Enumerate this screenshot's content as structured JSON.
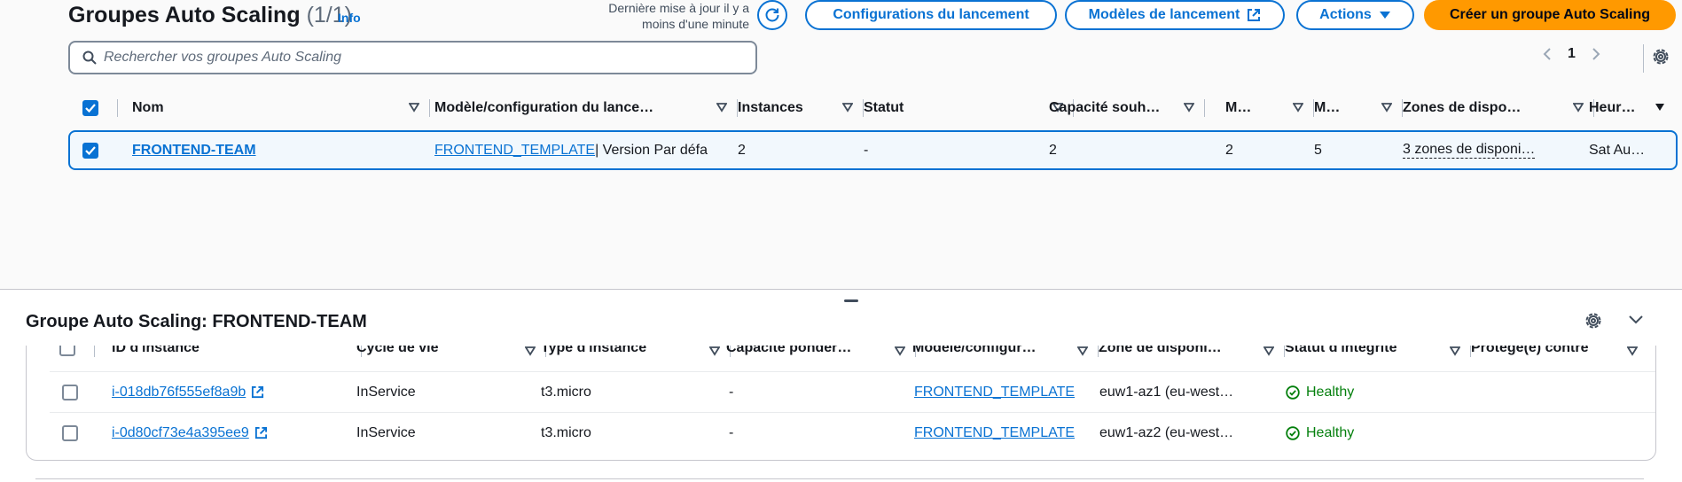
{
  "header": {
    "title": "Groupes Auto Scaling",
    "count": "(1/1)",
    "info": "Info",
    "updated_line1": "Dernière mise à jour il y a",
    "updated_line2": "moins d'une minute"
  },
  "toolbar": {
    "launch_configs": "Configurations du lancement",
    "launch_templates": "Modèles de lancement",
    "actions": "Actions",
    "create": "Créer un groupe Auto Scaling"
  },
  "search": {
    "placeholder": "Rechercher vos groupes Auto Scaling"
  },
  "pagination": {
    "page": "1"
  },
  "groups_table": {
    "columns": [
      "Nom",
      "Modèle/configuration du lance…",
      "Instances",
      "Statut",
      "Capacité souh…",
      "M…",
      "M…",
      "Zones de dispo…",
      "Heur…"
    ],
    "rows": [
      {
        "name": "FRONTEND-TEAM",
        "template_link": "FRONTEND_TEMPLATE",
        "template_suffix": " | Version Par défa",
        "instances": "2",
        "status": "-",
        "desired": "2",
        "min": "2",
        "max": "5",
        "zones": "3 zones de disponi…",
        "time": "Sat Au…"
      }
    ]
  },
  "details": {
    "title": "Groupe Auto Scaling: FRONTEND-TEAM",
    "columns": [
      "ID d'instance",
      "Cycle de vie",
      "Type d'instance",
      "Capacité pondér…",
      "Modèle/configur…",
      "Zone de disponi…",
      "Statut d'intégrité",
      "Protégé(e) contre"
    ],
    "rows": [
      {
        "id": "i-018db76f555ef8a9b",
        "lifecycle": "InService",
        "type": "t3.micro",
        "weight": "-",
        "template": "FRONTEND_TEMPLATE",
        "zone": "euw1-az1 (eu-west…",
        "health": "Healthy"
      },
      {
        "id": "i-0d80cf73e4a395ee9",
        "lifecycle": "InService",
        "type": "t3.micro",
        "weight": "-",
        "template": "FRONTEND_TEMPLATE",
        "zone": "euw1-az2 (eu-west…",
        "health": "Healthy"
      }
    ]
  },
  "colors": {
    "link": "#0972d3",
    "primary": "#ff9900",
    "healthy": "#037f0c",
    "selected_row_bg": "#f2f8fd"
  }
}
